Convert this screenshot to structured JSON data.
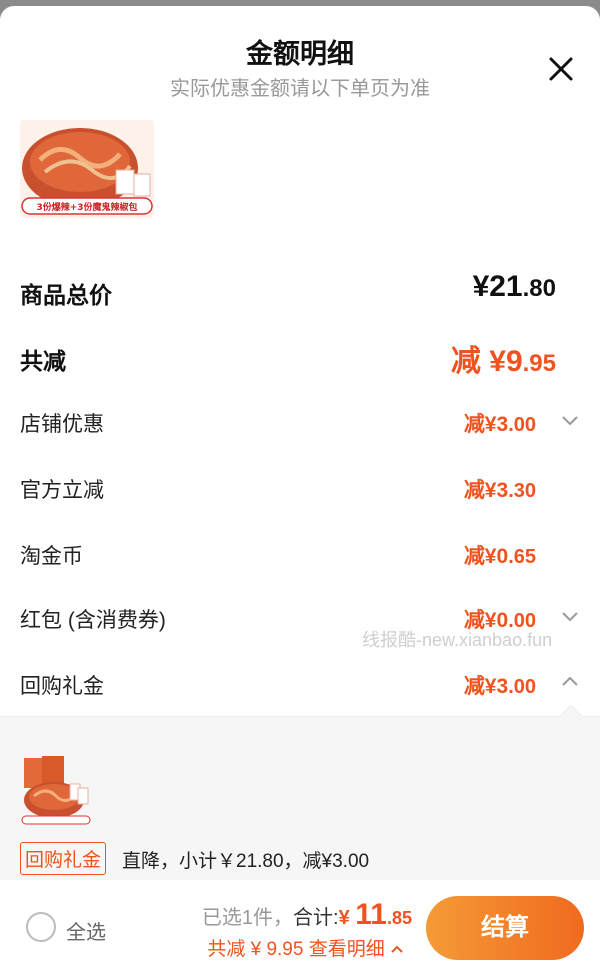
{
  "header": {
    "title": "金额明细",
    "subtitle": "实际优惠金额请以下单页为准"
  },
  "product": {
    "image_caption": "3份爆辣+3份魔鬼辣椒包"
  },
  "summary": {
    "total_label": "商品总价",
    "total_prefix": "¥",
    "total_int": "21",
    "total_dec": ".80",
    "discount_label": "共减",
    "discount_prefix": "减 ¥",
    "discount_int": "9",
    "discount_dec": ".95"
  },
  "discounts": [
    {
      "label": "店铺优惠",
      "prefix": "减¥",
      "int": "3",
      "dec": ".00",
      "chevron": "chevron-down-icon"
    },
    {
      "label": "官方立减",
      "prefix": "减¥",
      "int": "3",
      "dec": ".30"
    },
    {
      "label": "淘金币",
      "prefix": "减¥",
      "int": "0",
      "dec": ".65"
    },
    {
      "label": "红包 (含消费券)",
      "prefix": "减¥",
      "int": "0",
      "dec": ".00",
      "chevron": "chevron-down-icon"
    },
    {
      "label": "回购礼金",
      "prefix": "减¥",
      "int": "3",
      "dec": ".00",
      "chevron": "chevron-up-icon"
    }
  ],
  "watermark": "线报酷-new.xianbao.fun",
  "detail_panel": {
    "tag": "回购礼金",
    "description": "直降，小计￥21.80，减¥3.00"
  },
  "footer": {
    "select_all": "全选",
    "selected_text": "已选1件，",
    "total_label": "合计:",
    "total_prefix": "¥ ",
    "total_int": "11",
    "total_dec": ".85",
    "saved_text": "共减 ¥ 9.95  查看明细",
    "checkout_label": "结算"
  },
  "colors": {
    "accent": "#f0531e",
    "checkout_gradient_start": "#f59a38",
    "checkout_gradient_end": "#f06a1e"
  }
}
